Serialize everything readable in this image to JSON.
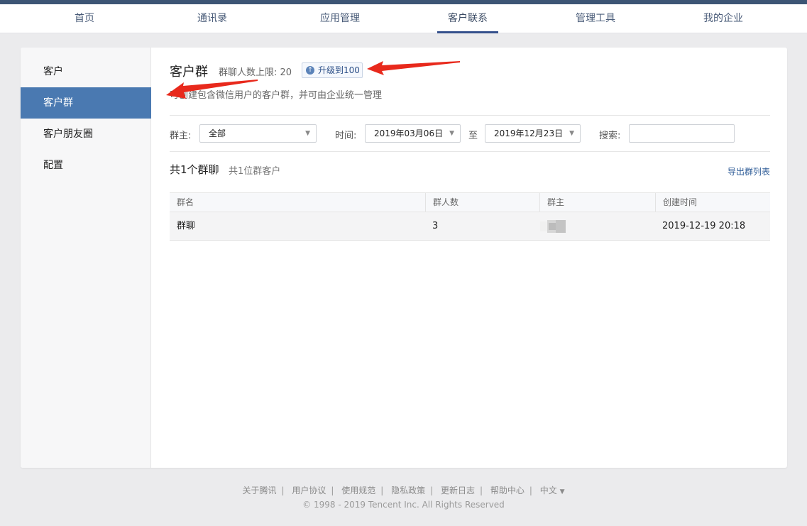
{
  "topnav": {
    "items": [
      {
        "label": "首页"
      },
      {
        "label": "通讯录"
      },
      {
        "label": "应用管理"
      },
      {
        "label": "客户联系"
      },
      {
        "label": "管理工具"
      },
      {
        "label": "我的企业"
      }
    ],
    "active_index": 3
  },
  "sidebar": {
    "items": [
      {
        "label": "客户"
      },
      {
        "label": "客户群"
      },
      {
        "label": "客户朋友圈"
      },
      {
        "label": "配置"
      }
    ],
    "active_index": 1
  },
  "main": {
    "title": "客户群",
    "limit_text": "群聊人数上限: 20",
    "upgrade_label": "升级到100",
    "description": "可创建包含微信用户的客户群，并可由企业统一管理",
    "filters": {
      "owner_label": "群主:",
      "owner_value": "全部",
      "time_label": "时间:",
      "start_date": "2019年03月06日",
      "to_label": "至",
      "end_date": "2019年12月23日",
      "search_label": "搜索:",
      "search_value": ""
    },
    "summary": {
      "groups": "共1个群聊",
      "customers": "共1位群客户"
    },
    "export_label": "导出群列表",
    "table": {
      "columns": [
        "群名",
        "群人数",
        "群主",
        "创建时间"
      ],
      "rows": [
        {
          "name": "群聊",
          "members": "3",
          "owner": "",
          "created": "2019-12-19 20:18"
        }
      ]
    }
  },
  "footer": {
    "links": [
      "关于腾讯",
      "用户协议",
      "使用规范",
      "隐私政策",
      "更新日志",
      "帮助中心"
    ],
    "language": "中文",
    "copyright": "© 1998 - 2019 Tencent Inc. All Rights Reserved"
  },
  "colors": {
    "accent": "#4a79b1",
    "nav_underline": "#35508c",
    "annotation_arrow": "#e8291c"
  },
  "icons": [
    "upgrade-arrow-icon",
    "dropdown-caret-icon"
  ]
}
